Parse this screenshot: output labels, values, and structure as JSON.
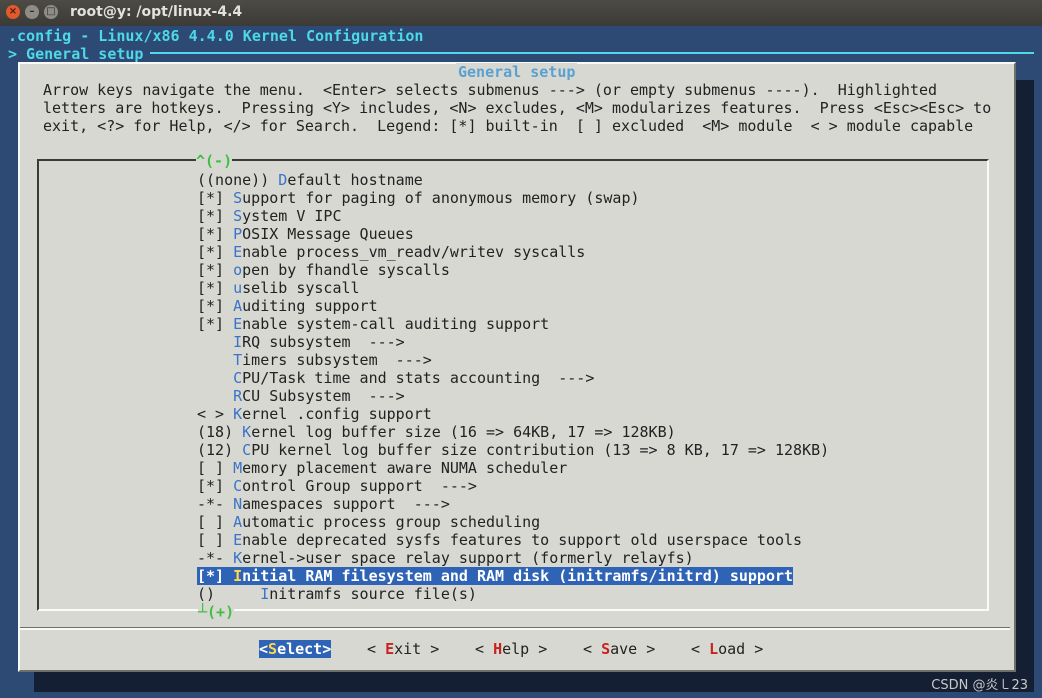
{
  "window": {
    "title": "root@y: /opt/linux-4.4"
  },
  "header": {
    "line1": ".config - Linux/x86 4.4.0 Kernel Configuration",
    "line2": "> General setup"
  },
  "dialog": {
    "title": "General setup",
    "help": [
      "Arrow keys navigate the menu.  <Enter> selects submenus ---> (or empty submenus ----).  Highlighted",
      "letters are hotkeys.  Pressing <Y> includes, <N> excludes, <M> modularizes features.  Press <Esc><Esc> to",
      "exit, <?> for Help, </> for Search.  Legend: [*] built-in  [ ] excluded  <M> module  < > module capable"
    ],
    "scroll_up": "^(-)",
    "scroll_down": "(+)"
  },
  "menu_items": [
    {
      "prefix": "((none)) ",
      "hotkey": "D",
      "rest": "efault hostname"
    },
    {
      "prefix": "[*] ",
      "hotkey": "S",
      "rest": "upport for paging of anonymous memory (swap)"
    },
    {
      "prefix": "[*] ",
      "hotkey": "S",
      "rest": "ystem V IPC"
    },
    {
      "prefix": "[*] ",
      "hotkey": "P",
      "rest": "OSIX Message Queues"
    },
    {
      "prefix": "[*] ",
      "hotkey": "E",
      "rest": "nable process_vm_readv/writev syscalls"
    },
    {
      "prefix": "[*] ",
      "hotkey": "o",
      "rest": "pen by fhandle syscalls"
    },
    {
      "prefix": "[*] ",
      "hotkey": "u",
      "rest": "selib syscall"
    },
    {
      "prefix": "[*] ",
      "hotkey": "A",
      "rest": "uditing support"
    },
    {
      "prefix": "[*] ",
      "hotkey": "E",
      "rest": "nable system-call auditing support"
    },
    {
      "prefix": "    ",
      "hotkey": "I",
      "rest": "RQ subsystem  --->"
    },
    {
      "prefix": "    ",
      "hotkey": "T",
      "rest": "imers subsystem  --->"
    },
    {
      "prefix": "    ",
      "hotkey": "C",
      "rest": "PU/Task time and stats accounting  --->"
    },
    {
      "prefix": "    ",
      "hotkey": "R",
      "rest": "CU Subsystem  --->"
    },
    {
      "prefix": "< > ",
      "hotkey": "K",
      "rest": "ernel .config support"
    },
    {
      "prefix": "(18) ",
      "hotkey": "K",
      "rest": "ernel log buffer size (16 => 64KB, 17 => 128KB)"
    },
    {
      "prefix": "(12) ",
      "hotkey": "C",
      "rest": "PU kernel log buffer size contribution (13 => 8 KB, 17 => 128KB)"
    },
    {
      "prefix": "[ ] ",
      "hotkey": "M",
      "rest": "emory placement aware NUMA scheduler"
    },
    {
      "prefix": "[*] ",
      "hotkey": "C",
      "rest": "ontrol Group support  --->"
    },
    {
      "prefix": "-*- ",
      "hotkey": "N",
      "rest": "amespaces support  --->"
    },
    {
      "prefix": "[ ] ",
      "hotkey": "A",
      "rest": "utomatic process group scheduling"
    },
    {
      "prefix": "[ ] ",
      "hotkey": "E",
      "rest": "nable deprecated sysfs features to support old userspace tools"
    },
    {
      "prefix": "-*- ",
      "hotkey": "K",
      "rest": "ernel->user space relay support (formerly relayfs)"
    },
    {
      "prefix": "[*] ",
      "hotkey": "I",
      "rest": "nitial RAM filesystem and RAM disk (initramfs/initrd) support",
      "selected": true
    },
    {
      "prefix": "()     ",
      "hotkey": "I",
      "rest": "nitramfs source file(s)"
    }
  ],
  "buttons": [
    {
      "open": "<",
      "key": "S",
      "rest": "elect",
      "close": ">",
      "active": true
    },
    {
      "open": "< ",
      "key": "E",
      "rest": "xit",
      "close": " >"
    },
    {
      "open": "< ",
      "key": "H",
      "rest": "elp",
      "close": " >"
    },
    {
      "open": "< ",
      "key": "S",
      "rest": "ave",
      "close": " >"
    },
    {
      "open": "< ",
      "key": "L",
      "rest": "oad",
      "close": " >"
    }
  ],
  "watermark": "CSDN @炎㇄23"
}
